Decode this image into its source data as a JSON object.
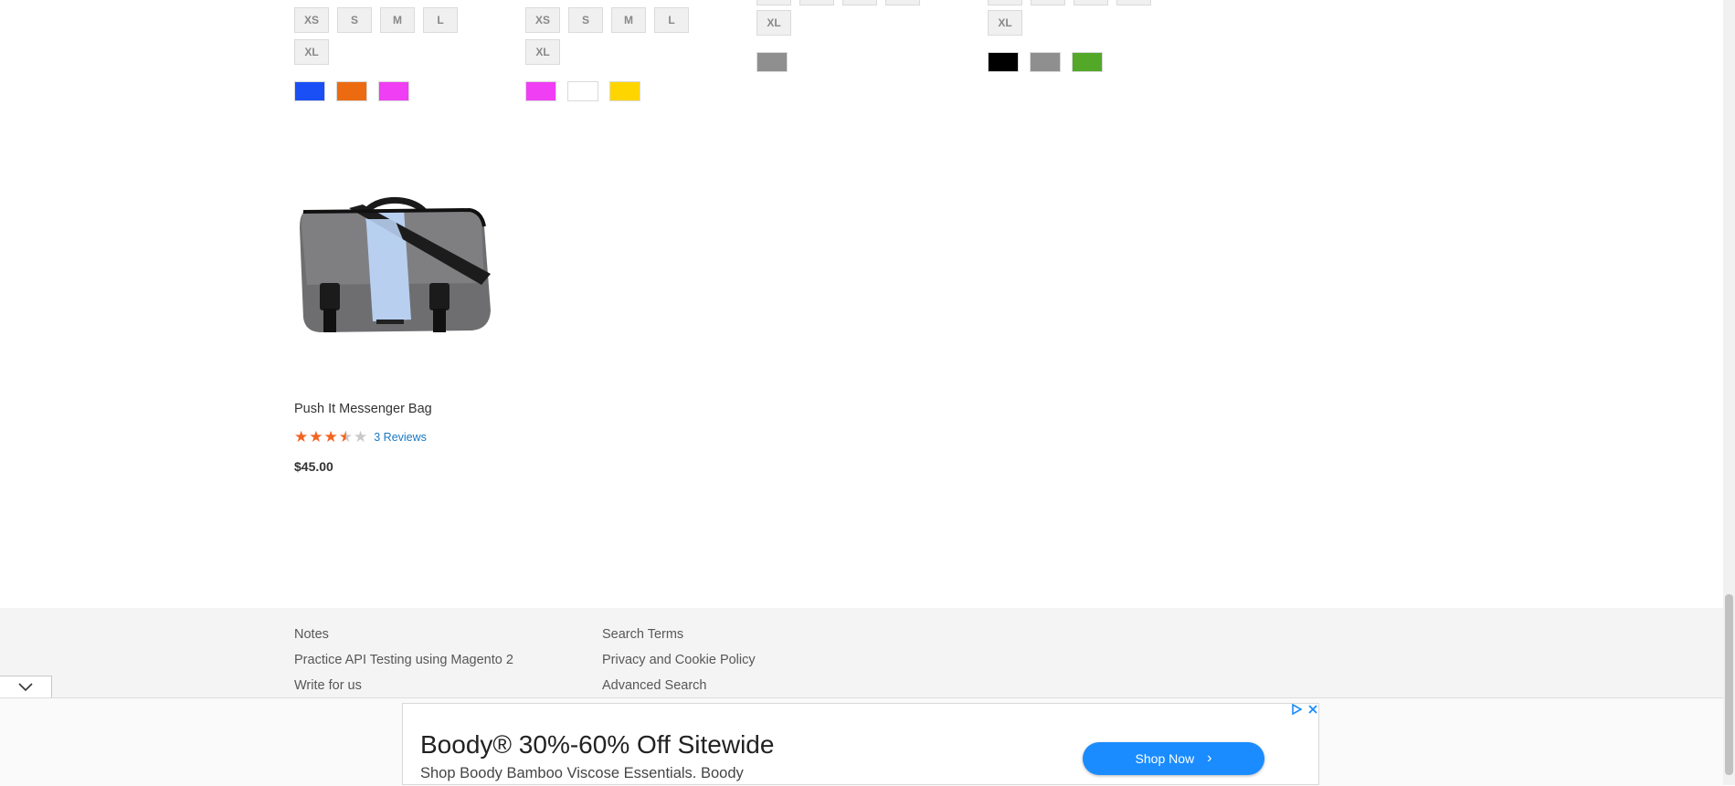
{
  "products_top": [
    {
      "sizes": [
        "XS",
        "S",
        "M",
        "L",
        "XL"
      ],
      "colors": [
        "#1a4ff5",
        "#ec6b11",
        "#ef3ef3"
      ]
    },
    {
      "sizes": [
        "XS",
        "S",
        "M",
        "L",
        "XL"
      ],
      "colors": [
        "#ef3ef3",
        "#ffffff",
        "#ffd500"
      ]
    },
    {
      "sizes": [
        "XL"
      ],
      "colors": [
        "#8f8f8f"
      ]
    },
    {
      "sizes": [
        "XL"
      ],
      "colors": [
        "#000000",
        "#8f8f8f",
        "#53a828"
      ]
    }
  ],
  "product": {
    "name": "Push It Messenger Bag",
    "rating_stars": 3.5,
    "rating_max": 5,
    "reviews_label": "3 Reviews",
    "price": "$45.00"
  },
  "footer": {
    "col1": [
      "Notes",
      "Practice API Testing using Magento 2",
      "Write for us"
    ],
    "col2": [
      "Search Terms",
      "Privacy and Cookie Policy",
      "Advanced Search"
    ]
  },
  "ad": {
    "headline": "Boody® 30%-60% Off Sitewide",
    "subtext": "Shop Boody Bamboo Viscose Essentials. Boody",
    "cta": "Shop Now",
    "cta_color": "#1a8cff"
  }
}
